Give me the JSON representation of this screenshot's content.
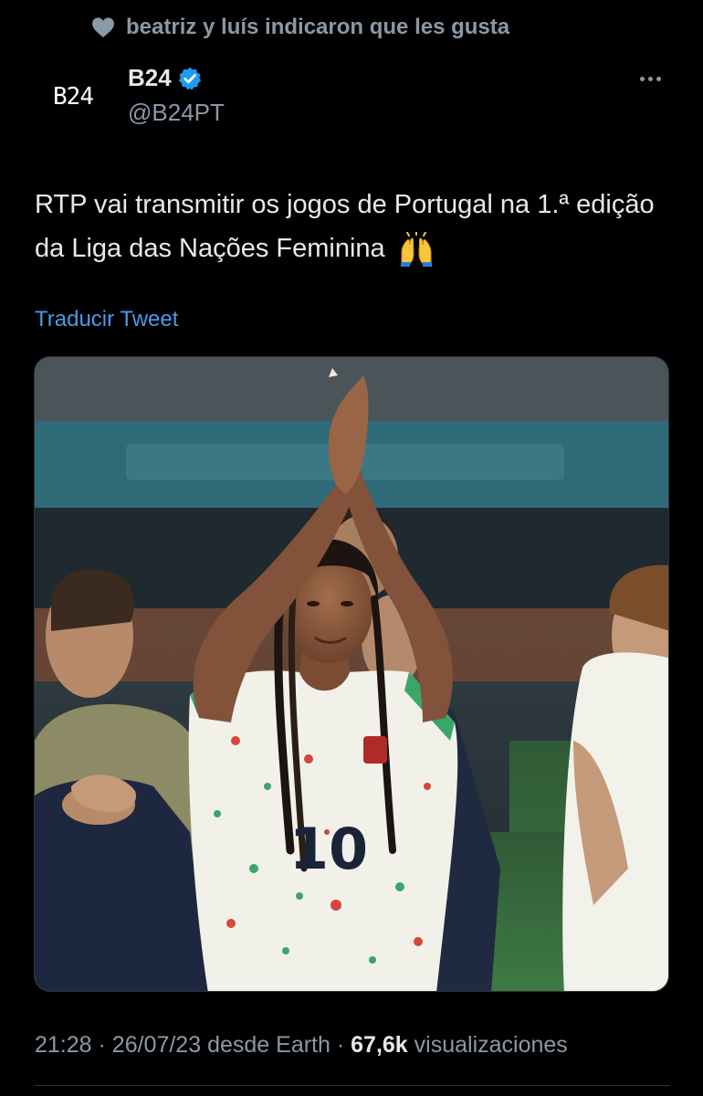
{
  "social_context": {
    "icon": "heart-icon",
    "text": "beatriz y luís indicaron que les gusta"
  },
  "author": {
    "avatar_text": "B24",
    "display_name": "B24",
    "verified_icon": "verified-badge-icon",
    "handle": "@B24PT"
  },
  "menu": {
    "icon": "more-options-icon"
  },
  "tweet": {
    "text": "RTP vai transmitir os jogos de Portugal na 1.ª edição da Liga das Nações Feminina",
    "emoji_icon": "raised-hands-icon",
    "translate_label": "Traducir Tweet"
  },
  "media": {
    "icon": "photo-footballer-applauding",
    "jersey_number": "10"
  },
  "meta": {
    "time": "21:28",
    "date": "26/07/23",
    "source": "desde Earth",
    "separator": "·",
    "views_count": "67,6k",
    "views_label": "visualizaciones"
  },
  "colors": {
    "background": "#000000",
    "text_primary": "#e7e9ea",
    "text_secondary": "#8b98a5",
    "link": "#4a99e9",
    "verified": "#1d9bf0"
  }
}
